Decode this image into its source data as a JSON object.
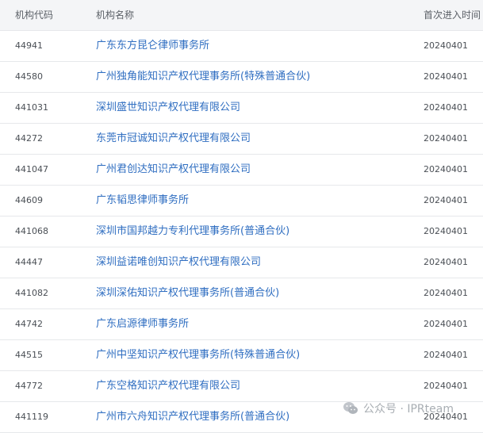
{
  "table": {
    "headers": {
      "code": "机构代码",
      "name": "机构名称",
      "date": "首次进入时间"
    },
    "rows": [
      {
        "code": "44941",
        "name": "广东东方昆仑律师事务所",
        "date": "20240401"
      },
      {
        "code": "44580",
        "name": "广州独角能知识产权代理事务所(特殊普通合伙)",
        "date": "20240401"
      },
      {
        "code": "441031",
        "name": "深圳盛世知识产权代理有限公司",
        "date": "20240401"
      },
      {
        "code": "44272",
        "name": "东莞市冠诚知识产权代理有限公司",
        "date": "20240401"
      },
      {
        "code": "441047",
        "name": "广州君创达知识产权代理有限公司",
        "date": "20240401"
      },
      {
        "code": "44609",
        "name": "广东韬思律师事务所",
        "date": "20240401"
      },
      {
        "code": "441068",
        "name": "深圳市国邦越力专利代理事务所(普通合伙)",
        "date": "20240401"
      },
      {
        "code": "44447",
        "name": "深圳益诺唯创知识产权代理有限公司",
        "date": "20240401"
      },
      {
        "code": "441082",
        "name": "深圳深佑知识产权代理事务所(普通合伙)",
        "date": "20240401"
      },
      {
        "code": "44742",
        "name": "广东启源律师事务所",
        "date": "20240401"
      },
      {
        "code": "44515",
        "name": "广州中坚知识产权代理事务所(特殊普通合伙)",
        "date": "20240401"
      },
      {
        "code": "44772",
        "name": "广东空格知识产权代理有限公司",
        "date": "20240401"
      },
      {
        "code": "441119",
        "name": "广州市六舟知识产权代理事务所(普通合伙)",
        "date": "20240401"
      }
    ]
  },
  "watermark": {
    "label": "公众号 · IPRteam",
    "icon": "wechat-icon"
  },
  "colors": {
    "header_bg": "#f4f5f7",
    "link": "#2f6ec1",
    "text": "#4a4f55",
    "divider": "#e6e8eb"
  }
}
